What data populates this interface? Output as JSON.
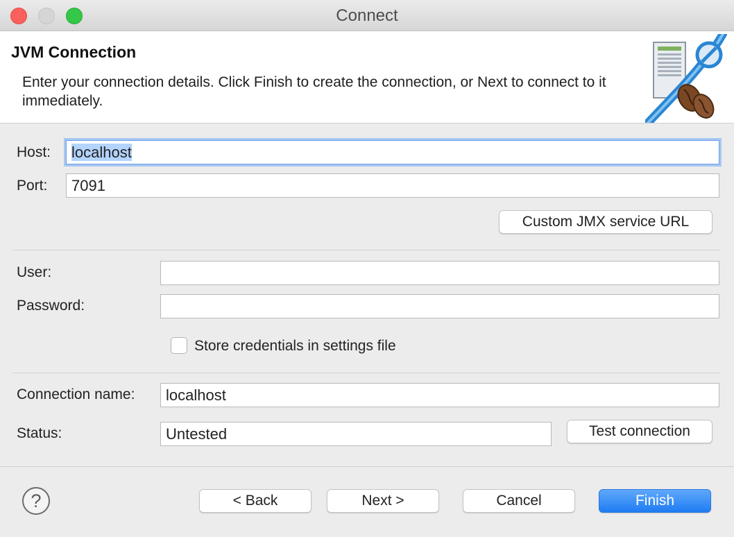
{
  "window": {
    "title": "Connect"
  },
  "banner": {
    "title": "JVM Connection",
    "description": "Enter your connection details. Click Finish to create the connection, or Next to connect to it immediately."
  },
  "form": {
    "host_label": "Host:",
    "host_value": "localhost",
    "port_label": "Port:",
    "port_value": "7091",
    "custom_jmx_button": "Custom JMX service URL",
    "user_label": "User:",
    "user_value": "",
    "password_label": "Password:",
    "password_value": "",
    "store_credentials_label": "Store credentials in settings file",
    "store_credentials_checked": false,
    "connection_name_label": "Connection name:",
    "connection_name_value": "localhost",
    "status_label": "Status:",
    "status_value": "Untested",
    "test_connection_button": "Test connection"
  },
  "footer": {
    "help_glyph": "?",
    "back_button": "< Back",
    "next_button": "Next >",
    "cancel_button": "Cancel",
    "finish_button": "Finish"
  },
  "colors": {
    "accent": "#1f7cf2",
    "focus_ring": "#a7c7f2",
    "selection": "#b3d4fc",
    "close": "#fc605c",
    "maximize": "#34c748"
  },
  "icons": {
    "banner": "jvm-connection-banner-icon",
    "help": "help-icon"
  }
}
